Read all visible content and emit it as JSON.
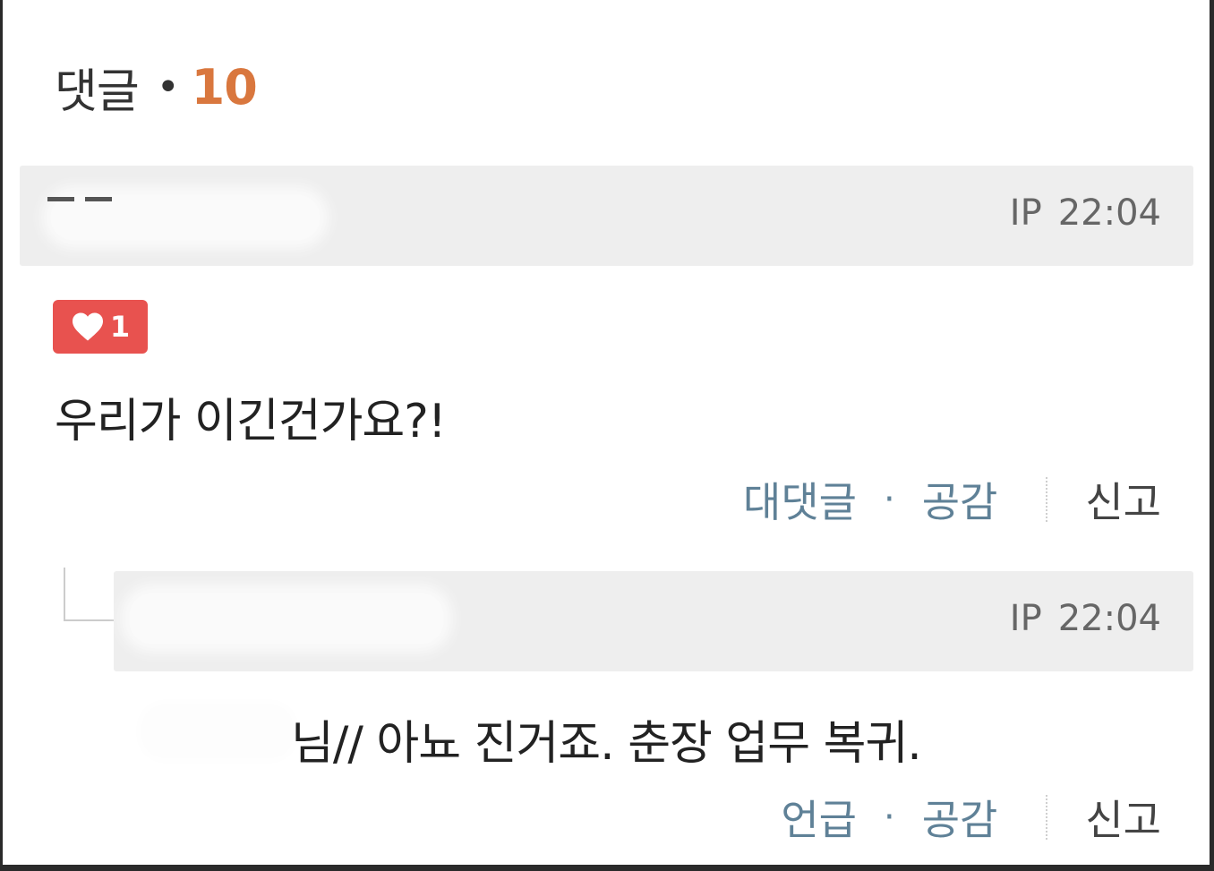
{
  "header": {
    "title": "댓글",
    "separator": "•",
    "count": "10"
  },
  "comments": [
    {
      "ip_label": "IP",
      "time": "22:04",
      "likes": "1",
      "text": "우리가 이긴건가요?!",
      "actions": {
        "reply": "대댓글",
        "like": "공감",
        "report": "신고"
      }
    },
    {
      "ip_label": "IP",
      "time": "22:04",
      "text": "님// 아뇨 진거죠. 춘장 업무 복귀.",
      "actions": {
        "mention": "언급",
        "like": "공감",
        "report": "신고"
      }
    }
  ],
  "colors": {
    "accent_count": "#d9773e",
    "like_badge": "#e8524f",
    "action_link": "#5f8197"
  }
}
